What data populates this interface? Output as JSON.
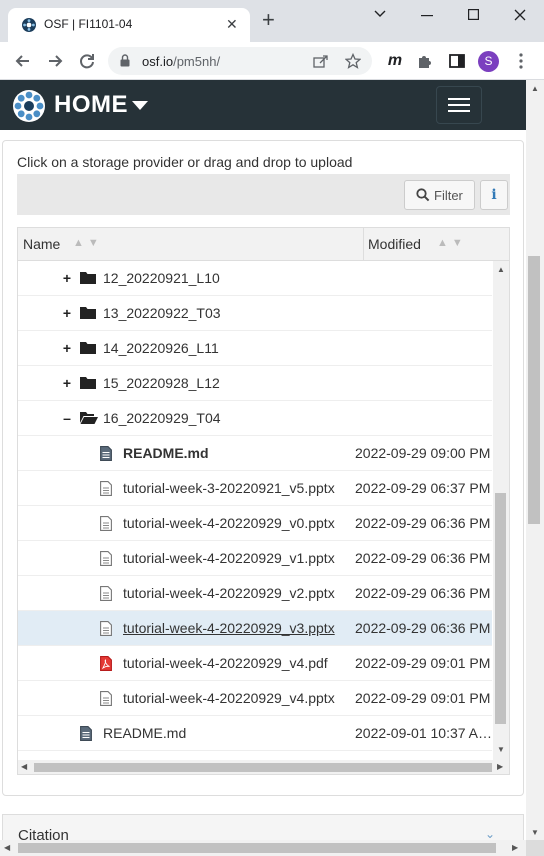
{
  "browser": {
    "tab_title": "OSF | FI1101-04",
    "new_tab": "+",
    "url_host": "osf.io",
    "url_path": "/pm5nh/",
    "profile_initial": "S",
    "colors": {
      "titlebar": "#dee1e6",
      "profile": "#7b3fbf"
    }
  },
  "navbar": {
    "home_label": "HOME",
    "colors": {
      "background": "#263238"
    }
  },
  "files": {
    "hint": "Click on a storage provider or drag and drop to upload",
    "filter_label": "Filter",
    "info_label": "i",
    "columns": {
      "name": "Name",
      "modified": "Modified"
    },
    "rows": [
      {
        "name": "12_20220921_L10",
        "type": "folder",
        "toggle": "+",
        "modified": ""
      },
      {
        "name": "13_20220922_T03",
        "type": "folder",
        "toggle": "+",
        "modified": ""
      },
      {
        "name": "14_20220926_L11",
        "type": "folder",
        "toggle": "+",
        "modified": ""
      },
      {
        "name": "15_20220928_L12",
        "type": "folder",
        "toggle": "+",
        "modified": ""
      },
      {
        "name": "16_20220929_T04",
        "type": "folder-open",
        "toggle": "–",
        "modified": ""
      },
      {
        "name": "README.md",
        "type": "markdown",
        "modified": "2022-09-29 09:00 PM"
      },
      {
        "name": "tutorial-week-3-20220921_v5.pptx",
        "type": "file",
        "modified": "2022-09-29 06:37 PM"
      },
      {
        "name": "tutorial-week-4-20220929_v0.pptx",
        "type": "file",
        "modified": "2022-09-29 06:36 PM"
      },
      {
        "name": "tutorial-week-4-20220929_v1.pptx",
        "type": "file",
        "modified": "2022-09-29 06:36 PM"
      },
      {
        "name": "tutorial-week-4-20220929_v2.pptx",
        "type": "file",
        "modified": "2022-09-29 06:36 PM"
      },
      {
        "name": "tutorial-week-4-20220929_v3.pptx",
        "type": "file",
        "modified": "2022-09-29 06:36 PM",
        "selected": true
      },
      {
        "name": "tutorial-week-4-20220929_v4.pdf",
        "type": "pdf",
        "modified": "2022-09-29 09:01 PM"
      },
      {
        "name": "tutorial-week-4-20220929_v4.pptx",
        "type": "file",
        "modified": "2022-09-29 09:01 PM"
      },
      {
        "name": "README.md",
        "type": "markdown",
        "modified": "2022-09-01 10:37 A…"
      }
    ]
  },
  "citation": {
    "label": "Citation"
  }
}
